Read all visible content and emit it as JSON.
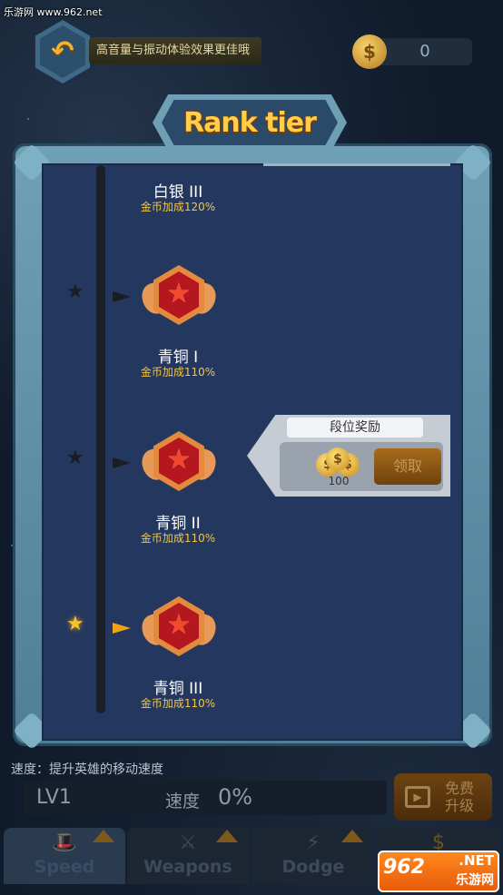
{
  "watermark_top": "乐游网 www.962.net",
  "top_bar": {
    "back_glyph": "↶",
    "tip_text": "高音量与振动体验效果更佳哦",
    "coin_symbol": "$",
    "coin_count": "0"
  },
  "panel": {
    "title": "Rank tier",
    "tiers": [
      {
        "name": "白银 III",
        "bonus": "金币加成120%",
        "achieved": false
      },
      {
        "name": "青铜 I",
        "bonus": "金币加成110%",
        "achieved": false
      },
      {
        "name": "青铜 II",
        "bonus": "金币加成110%",
        "achieved": false
      },
      {
        "name": "青铜 III",
        "bonus": "金币加成110%",
        "achieved": true
      }
    ],
    "reward": {
      "title": "段位奖励",
      "amount": "100",
      "claim_label": "领取"
    }
  },
  "bottom": {
    "description": "速度：提升英雄的移动速度",
    "level": "LV1",
    "stat_label": "速度",
    "stat_value": "0%",
    "upgrade_label": "免费 升级"
  },
  "tabs": [
    {
      "label": "Speed",
      "active": true
    },
    {
      "label": "Weapons",
      "active": false
    },
    {
      "label": "Dodge",
      "active": false
    }
  ],
  "watermark_bottom": {
    "brand": "962",
    "net": ".NET",
    "site": "乐游网"
  },
  "colors": {
    "gold": "#f2c54a",
    "panel": "#24385f",
    "frame": "#6fa0b6",
    "active_star": "#f7c12e"
  }
}
